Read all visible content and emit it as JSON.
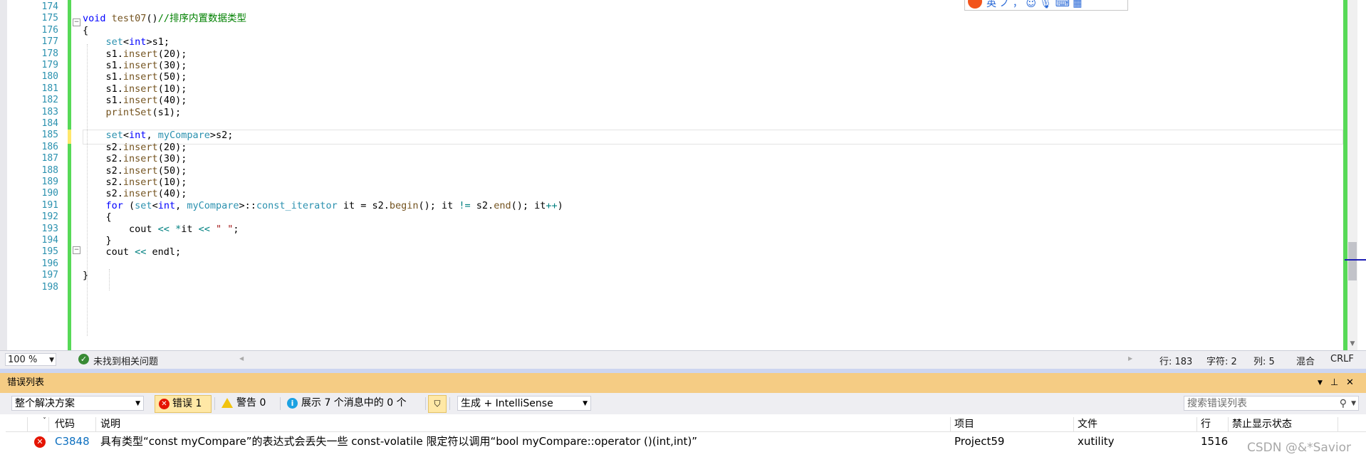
{
  "editor": {
    "line_numbers": [
      "174",
      "175",
      "176",
      "177",
      "178",
      "179",
      "180",
      "181",
      "182",
      "183",
      "184",
      "185",
      "186",
      "187",
      "188",
      "189",
      "190",
      "191",
      "192",
      "193",
      "194",
      "195",
      "196",
      "197",
      "198"
    ],
    "lines": [
      [],
      [
        {
          "t": "void",
          "c": "k"
        },
        {
          "t": " test07",
          "c": "fn"
        },
        {
          "t": "()",
          "c": ""
        },
        {
          "t": "//排序内置数据类型",
          "c": "cm"
        }
      ],
      [
        {
          "t": "{",
          "c": ""
        }
      ],
      [
        {
          "t": "    set",
          "c": "ty"
        },
        {
          "t": "<",
          "c": ""
        },
        {
          "t": "int",
          "c": "k"
        },
        {
          "t": ">s1;",
          "c": ""
        }
      ],
      [
        {
          "t": "    s1.",
          "c": ""
        },
        {
          "t": "insert",
          "c": "fn"
        },
        {
          "t": "(20);",
          "c": ""
        }
      ],
      [
        {
          "t": "    s1.",
          "c": ""
        },
        {
          "t": "insert",
          "c": "fn"
        },
        {
          "t": "(30);",
          "c": ""
        }
      ],
      [
        {
          "t": "    s1.",
          "c": ""
        },
        {
          "t": "insert",
          "c": "fn"
        },
        {
          "t": "(50);",
          "c": ""
        }
      ],
      [
        {
          "t": "    s1.",
          "c": ""
        },
        {
          "t": "insert",
          "c": "fn"
        },
        {
          "t": "(10);",
          "c": ""
        }
      ],
      [
        {
          "t": "    s1.",
          "c": ""
        },
        {
          "t": "insert",
          "c": "fn"
        },
        {
          "t": "(40);",
          "c": ""
        }
      ],
      [
        {
          "t": "    printSet",
          "c": "fn"
        },
        {
          "t": "(s1);",
          "c": ""
        }
      ],
      [],
      [
        {
          "t": "    set",
          "c": "ty"
        },
        {
          "t": "<",
          "c": ""
        },
        {
          "t": "int",
          "c": "k"
        },
        {
          "t": ", ",
          "c": ""
        },
        {
          "t": "myCompare",
          "c": "ty"
        },
        {
          "t": ">s2;",
          "c": ""
        }
      ],
      [
        {
          "t": "    s2.",
          "c": ""
        },
        {
          "t": "insert",
          "c": "fn"
        },
        {
          "t": "(20);",
          "c": ""
        }
      ],
      [
        {
          "t": "    s2.",
          "c": ""
        },
        {
          "t": "insert",
          "c": "fn"
        },
        {
          "t": "(30);",
          "c": ""
        }
      ],
      [
        {
          "t": "    s2.",
          "c": ""
        },
        {
          "t": "insert",
          "c": "fn"
        },
        {
          "t": "(50);",
          "c": ""
        }
      ],
      [
        {
          "t": "    s2.",
          "c": ""
        },
        {
          "t": "insert",
          "c": "fn"
        },
        {
          "t": "(10);",
          "c": ""
        }
      ],
      [
        {
          "t": "    s2.",
          "c": ""
        },
        {
          "t": "insert",
          "c": "fn"
        },
        {
          "t": "(40);",
          "c": ""
        }
      ],
      [
        {
          "t": "    for",
          "c": "k"
        },
        {
          "t": " (",
          "c": ""
        },
        {
          "t": "set",
          "c": "ty"
        },
        {
          "t": "<",
          "c": ""
        },
        {
          "t": "int",
          "c": "k"
        },
        {
          "t": ", ",
          "c": ""
        },
        {
          "t": "myCompare",
          "c": "ty"
        },
        {
          "t": ">::",
          "c": ""
        },
        {
          "t": "const_iterator",
          "c": "ty"
        },
        {
          "t": " it = s2.",
          "c": ""
        },
        {
          "t": "begin",
          "c": "fn"
        },
        {
          "t": "(); it ",
          "c": ""
        },
        {
          "t": "!=",
          "c": "op"
        },
        {
          "t": " s2.",
          "c": ""
        },
        {
          "t": "end",
          "c": "fn"
        },
        {
          "t": "(); it",
          "c": ""
        },
        {
          "t": "++",
          "c": "op"
        },
        {
          "t": ")",
          "c": ""
        }
      ],
      [
        {
          "t": "    {",
          "c": ""
        }
      ],
      [
        {
          "t": "        cout ",
          "c": ""
        },
        {
          "t": "<<",
          "c": "op"
        },
        {
          "t": " ",
          "c": ""
        },
        {
          "t": "*",
          "c": "op"
        },
        {
          "t": "it ",
          "c": ""
        },
        {
          "t": "<<",
          "c": "op"
        },
        {
          "t": " ",
          "c": ""
        },
        {
          "t": "\" \"",
          "c": "st"
        },
        {
          "t": ";",
          "c": ""
        }
      ],
      [
        {
          "t": "    }",
          "c": ""
        }
      ],
      [
        {
          "t": "    cout ",
          "c": ""
        },
        {
          "t": "<<",
          "c": "op"
        },
        {
          "t": " endl;",
          "c": ""
        }
      ],
      [],
      [
        {
          "t": "}",
          "c": ""
        }
      ],
      []
    ]
  },
  "ime_toolbar": {
    "text": "英 ノ ， ☺ 🎙 ⌨ ▦"
  },
  "status_bar": {
    "zoom": "100 %",
    "issues": "未找到相关问题",
    "line": "行: 183",
    "char": "字符: 2",
    "col": "列: 5",
    "mode": "混合",
    "eol": "CRLF"
  },
  "error_list": {
    "title": "错误列表",
    "scope": "整个解决方案",
    "errors_label": "错误 1",
    "warnings_label": "警告 0",
    "messages_label": "展示 7 个消息中的 0 个",
    "build_filter": "生成 + IntelliSense",
    "search_placeholder": "搜索错误列表",
    "columns": {
      "code": "代码",
      "description": "说明",
      "project": "项目",
      "file": "文件",
      "line": "行",
      "suppression": "禁止显示状态"
    },
    "rows": [
      {
        "code": "C3848",
        "description": "具有类型“const myCompare”的表达式会丢失一些 const-volatile 限定符以调用“bool myCompare::operator ()(int,int)”",
        "project": "Project59",
        "file": "xutility",
        "line": "1516",
        "suppression": ""
      }
    ]
  },
  "watermark": "CSDN @&*Savior",
  "colors": {
    "accent_panel": "#f5cc84",
    "error_red": "#e51400",
    "keyword_blue": "#0000ff",
    "type_teal": "#2b91af",
    "comment_green": "#008000",
    "change_bar_green": "#57d957"
  }
}
